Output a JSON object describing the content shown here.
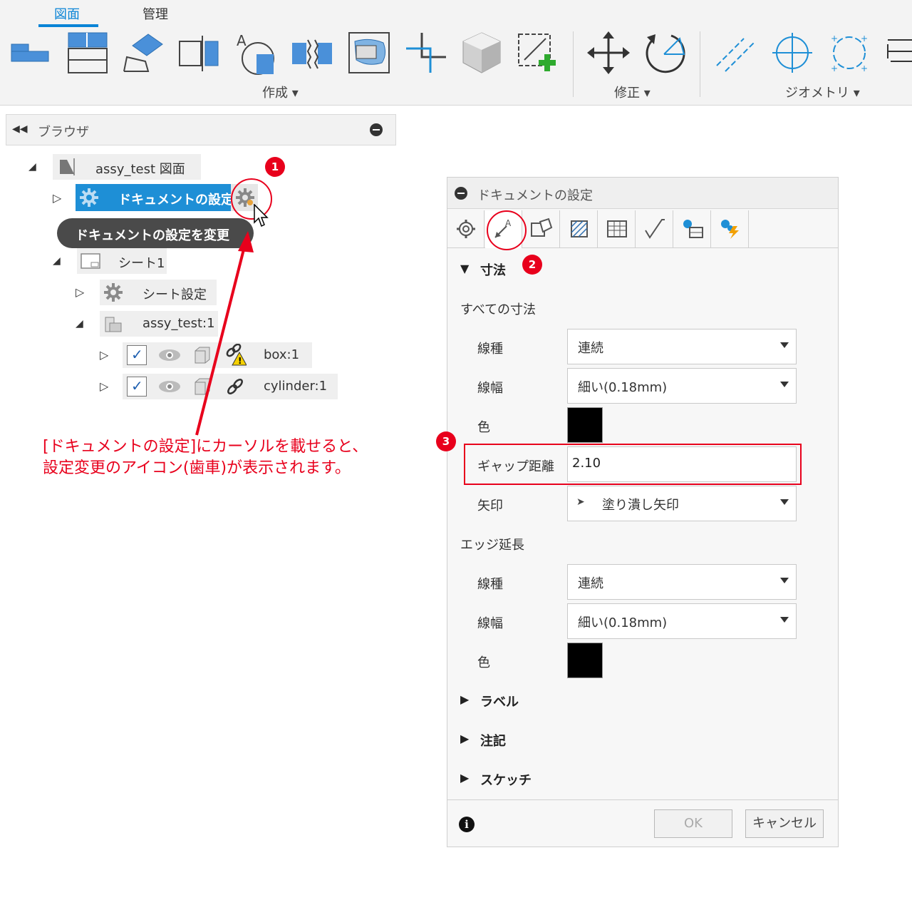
{
  "ribbon": {
    "tabs": [
      {
        "label": "図面",
        "active": true
      },
      {
        "label": "管理",
        "active": false
      }
    ],
    "groups": {
      "create_label": "作成",
      "modify_label": "修正",
      "geometry_label": "ジオメトリ"
    },
    "accent_color": "#0a84d6"
  },
  "browser": {
    "title": "ブラウザ",
    "tree": {
      "root": "assy_test 図面",
      "document_settings": "ドキュメントの設定",
      "tooltip": "ドキュメントの設定を変更",
      "sheet": "シート1",
      "sheet_settings": "シート設定",
      "assembly": "assy_test:1",
      "components": [
        {
          "name": "box:1",
          "warning": true
        },
        {
          "name": "cylinder:1",
          "warning": false
        }
      ]
    },
    "highlight_color": "#1e8fd6"
  },
  "annotation": {
    "line1": "[ドキュメントの設定]にカーソルを載せると、",
    "line2": "設定変更のアイコン(歯車)が表示されます。",
    "color": "#e8001c",
    "badges": [
      "1",
      "2",
      "3"
    ]
  },
  "dialog": {
    "title": "ドキュメントの設定",
    "dimension_section": "寸法",
    "all_dimensions": "すべての寸法",
    "labels": {
      "line_type": "線種",
      "line_width": "線幅",
      "color": "色",
      "gap": "ギャップ距離",
      "arrow": "矢印"
    },
    "all_dims_values": {
      "line_type": "連続",
      "line_width": "細い(0.18mm)",
      "gap": "2.10",
      "arrow": "塗り潰し矢印"
    },
    "edge_extension": "エッジ延長",
    "edge_values": {
      "line_type": "連続",
      "line_width": "細い(0.18mm)"
    },
    "collapsed_sections": [
      "ラベル",
      "注記",
      "スケッチ"
    ],
    "ok_label": "OK",
    "cancel_label": "キャンセル"
  }
}
